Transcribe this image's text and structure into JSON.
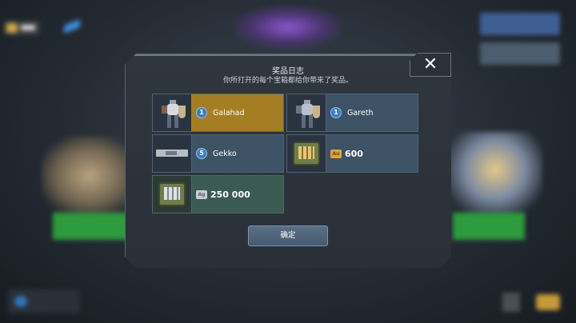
{
  "dialog": {
    "title": "奖品日志",
    "subtitle": "你所打开的每个宝箱都给你带来了奖品。",
    "close_glyph": "✕",
    "confirm_label": "确定"
  },
  "rewards": [
    {
      "name": "Galahad",
      "count": "1",
      "icon": "galahad-robot-icon",
      "highlight": "#a57e24"
    },
    {
      "name": "Gareth",
      "count": "1",
      "icon": "gareth-robot-icon"
    },
    {
      "name": "Gekko",
      "count": "5",
      "icon": "gekko-weapon-icon"
    },
    {
      "amount": "600",
      "currency": "Au",
      "icon": "gold-crate-icon"
    },
    {
      "amount": "250 000",
      "currency": "Ag",
      "icon": "silver-crate-icon"
    }
  ],
  "colors": {
    "card": "#3e5266",
    "gold_card": "#a57e24",
    "silver_card": "#3a5a52",
    "badge": "#3b7fc2"
  }
}
